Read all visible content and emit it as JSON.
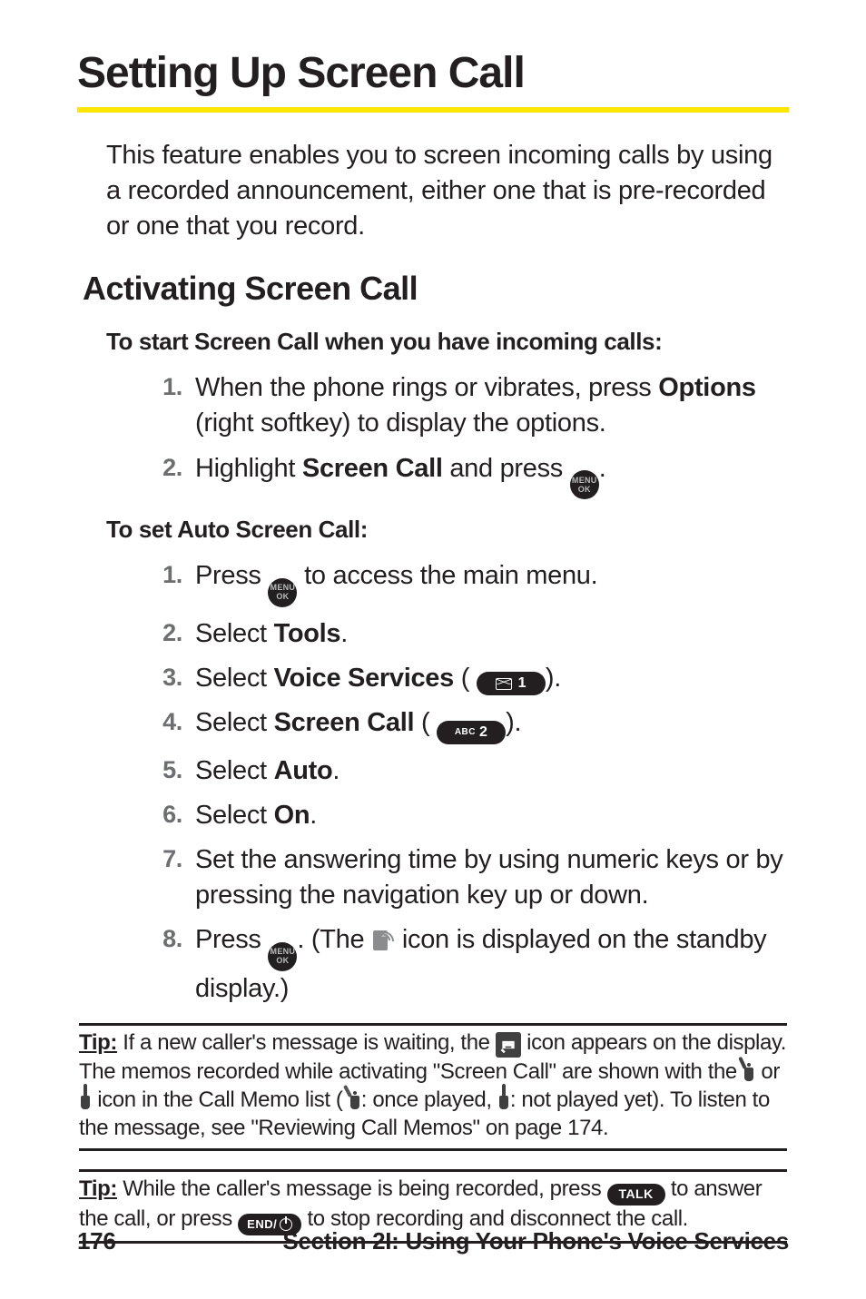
{
  "title": "Setting Up Screen Call",
  "intro": "This feature enables you to screen incoming calls by using a recorded announcement, either one that is pre-recorded or one that you record.",
  "subhead": "Activating Screen Call",
  "lead1": "To start Screen Call when you have incoming calls:",
  "listA": {
    "n1": "1.",
    "s1a": "When the phone rings or vibrates, press ",
    "s1b": "Options",
    "s1c": " (right softkey) to display the options.",
    "n2": "2.",
    "s2a": "Highlight ",
    "s2b": "Screen Call",
    "s2c": " and press ",
    "s2d": "."
  },
  "lead2": "To set Auto Screen Call:",
  "listB": {
    "n1": "1.",
    "s1a": "Press ",
    "s1b": " to access the main menu.",
    "n2": "2.",
    "s2a": "Select ",
    "s2b": "Tools",
    "s2c": ".",
    "n3": "3.",
    "s3a": "Select ",
    "s3b": "Voice Services",
    "s3c": " (",
    "s3d": ").",
    "n4": "4.",
    "s4a": "Select ",
    "s4b": "Screen Call",
    "s4c": " (",
    "s4d": ").",
    "n5": "5.",
    "s5a": "Select ",
    "s5b": "Auto",
    "s5c": ".",
    "n6": "6.",
    "s6a": "Select ",
    "s6b": "On",
    "s6c": ".",
    "n7": "7.",
    "s7": "Set the answering time by using numeric keys or by pressing the navigation key up or down.",
    "n8": "8.",
    "s8a": "Press ",
    "s8b": ". (The ",
    "s8c": " icon is displayed on the standby display.)"
  },
  "keys": {
    "menu_top": "MENU",
    "menu_bot": "OK",
    "abc": "ABC",
    "num1": "1",
    "num2": "2",
    "talk": "TALK",
    "end": "END/",
    "power_aria": "power"
  },
  "tip1": {
    "label": "Tip:",
    "a": " If a new caller's message is waiting, the ",
    "b": " icon appears on the display. The memos recorded while activating \"Screen Call\" are shown with the ",
    "c": " or ",
    "d": " icon in the Call Memo list (",
    "e": ": once played, ",
    "f": ": not played yet). To listen to the message, see \"Reviewing Call Memos\" on page 174."
  },
  "tip2": {
    "label": "Tip:",
    "a": " While the caller's message is being recorded, press ",
    "b": " to answer the call, or press ",
    "c": " to stop recording and disconnect the call."
  },
  "footer": {
    "page": "176",
    "section": "Section 2I: Using Your Phone's Voice Services"
  }
}
